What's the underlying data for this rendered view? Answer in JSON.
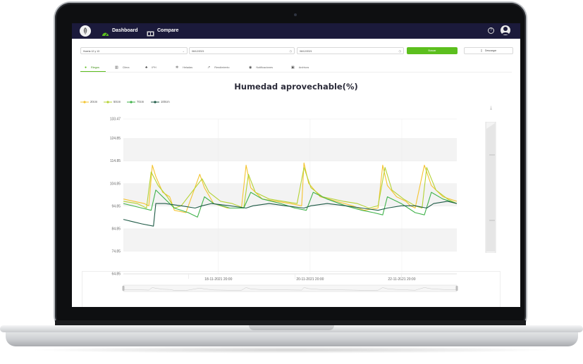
{
  "nav": {
    "dashboard_label": "Dashboard",
    "compare_label": "Compare",
    "help_symbol": "?"
  },
  "filters": {
    "site_value": "Huerta 12 y 13",
    "date_from": "06/12/2021",
    "date_to": "06/12/2021",
    "search_label": "Buscar",
    "download_label": "Descargar"
  },
  "tabs": [
    {
      "label": "Riegos"
    },
    {
      "label": "Clima"
    },
    {
      "label": "IPH"
    },
    {
      "label": "Heladas"
    },
    {
      "label": "Rendimiento"
    },
    {
      "label": "Notificaciones"
    },
    {
      "label": "Archivos"
    }
  ],
  "chart_data": {
    "type": "line",
    "title": "Humedad aprovechable(%)",
    "ylim": [
      64.85,
      133.47
    ],
    "yticks": [
      "133.47",
      "124.85",
      "114.85",
      "104.85",
      "94.85",
      "84.85",
      "74.85",
      "64.85"
    ],
    "xticks": [
      "18-11-2021 20:00",
      "20-11-2021 20:00",
      "22-11-2021 20:00"
    ],
    "xlim": [
      0,
      144
    ],
    "grid": "horizontal bands",
    "legend_position": "top-left",
    "series": [
      {
        "name": "20cm",
        "color": "#f4c430",
        "points": [
          [
            0,
            98
          ],
          [
            9,
            96
          ],
          [
            11,
            95
          ],
          [
            12.5,
            113
          ],
          [
            14,
            108
          ],
          [
            17,
            101
          ],
          [
            20,
            99
          ],
          [
            22,
            93
          ],
          [
            27,
            92
          ],
          [
            33,
            109
          ],
          [
            35,
            103
          ],
          [
            39,
            96
          ],
          [
            45,
            94
          ],
          [
            51,
            94
          ],
          [
            53,
            113
          ],
          [
            55,
            103
          ],
          [
            60,
            98
          ],
          [
            66,
            97
          ],
          [
            72,
            96
          ],
          [
            77,
            95
          ],
          [
            78,
            114
          ],
          [
            80,
            105
          ],
          [
            85,
            99
          ],
          [
            92,
            97
          ],
          [
            99,
            95
          ],
          [
            104,
            93
          ],
          [
            110,
            94
          ],
          [
            112,
            113
          ],
          [
            114,
            104
          ],
          [
            118,
            99
          ],
          [
            122,
            97
          ],
          [
            124,
            95
          ],
          [
            126,
            94
          ],
          [
            130,
            113
          ],
          [
            133,
            104
          ],
          [
            138,
            99
          ],
          [
            144,
            97
          ]
        ]
      },
      {
        "name": "50cm",
        "color": "#b5d334",
        "points": [
          [
            0,
            97
          ],
          [
            6,
            96
          ],
          [
            10,
            94
          ],
          [
            12,
            110
          ],
          [
            15,
            104
          ],
          [
            19,
            99
          ],
          [
            22,
            94
          ],
          [
            25,
            95
          ],
          [
            34,
            107
          ],
          [
            37,
            101
          ],
          [
            42,
            97
          ],
          [
            47,
            96
          ],
          [
            52,
            94
          ],
          [
            54,
            109
          ],
          [
            57,
            101
          ],
          [
            63,
            98
          ],
          [
            69,
            97
          ],
          [
            75,
            96
          ],
          [
            78,
            112
          ],
          [
            81,
            103
          ],
          [
            86,
            99
          ],
          [
            95,
            97
          ],
          [
            101,
            96
          ],
          [
            106,
            94
          ],
          [
            110,
            95
          ],
          [
            113,
            112
          ],
          [
            116,
            102
          ],
          [
            121,
            98
          ],
          [
            126,
            95
          ],
          [
            129,
            94
          ],
          [
            131,
            112
          ],
          [
            135,
            102
          ],
          [
            140,
            98
          ],
          [
            144,
            96
          ]
        ]
      },
      {
        "name": "70cm",
        "color": "#3fb24a",
        "points": [
          [
            0,
            96
          ],
          [
            8,
            94
          ],
          [
            12,
            93
          ],
          [
            14,
            102
          ],
          [
            17,
            99
          ],
          [
            22,
            94
          ],
          [
            28,
            92
          ],
          [
            32,
            90
          ],
          [
            35,
            99
          ],
          [
            39,
            96
          ],
          [
            46,
            94
          ],
          [
            52,
            94
          ],
          [
            55,
            101
          ],
          [
            60,
            98
          ],
          [
            68,
            96
          ],
          [
            74,
            94
          ],
          [
            79,
            93
          ],
          [
            82,
            101
          ],
          [
            88,
            98
          ],
          [
            96,
            95
          ],
          [
            103,
            93
          ],
          [
            108,
            92
          ],
          [
            112,
            91
          ],
          [
            114,
            99
          ],
          [
            120,
            96
          ],
          [
            126,
            92
          ],
          [
            130,
            91
          ],
          [
            133,
            101
          ],
          [
            138,
            98
          ],
          [
            144,
            96
          ]
        ]
      },
      {
        "name": "100cm",
        "color": "#1e5a46",
        "points": [
          [
            0,
            89
          ],
          [
            4,
            88
          ],
          [
            8,
            87
          ],
          [
            13,
            86
          ],
          [
            14,
            96
          ],
          [
            18,
            96
          ],
          [
            25,
            95
          ],
          [
            31,
            94
          ],
          [
            34,
            95
          ],
          [
            38,
            96
          ],
          [
            46,
            95
          ],
          [
            53,
            94
          ],
          [
            56,
            95
          ],
          [
            63,
            96
          ],
          [
            70,
            95
          ],
          [
            78,
            94
          ],
          [
            81,
            95
          ],
          [
            88,
            96
          ],
          [
            96,
            95
          ],
          [
            103,
            94
          ],
          [
            110,
            93
          ],
          [
            114,
            94
          ],
          [
            120,
            95
          ],
          [
            126,
            95
          ],
          [
            131,
            94
          ],
          [
            134,
            96
          ],
          [
            140,
            97
          ],
          [
            144,
            96
          ]
        ]
      }
    ]
  },
  "colors": {
    "topbar": "#1b1a3b",
    "accent": "#5cbf1e"
  }
}
